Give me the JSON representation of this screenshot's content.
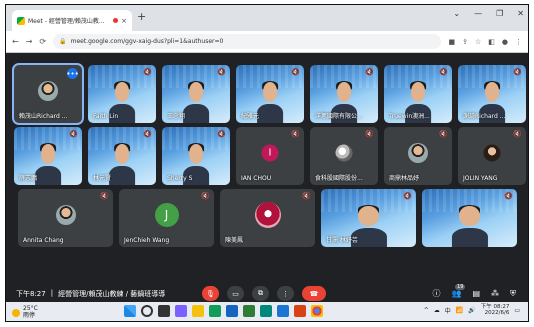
{
  "browser": {
    "tab_title": "Meet - 經營管理/賴茂山教...",
    "tab_close": "×",
    "new_tab": "+",
    "window_controls": [
      "⌄",
      "—",
      "❐",
      "✕"
    ],
    "url": "meet.google.com/ggv-xaig-dus?pli=1&authuser=0"
  },
  "participants_row1": [
    {
      "name": "賴茂山Richard ...",
      "style": "dark",
      "avatar": "face"
    },
    {
      "name": "Faith Lin",
      "style": "blue"
    },
    {
      "name": "王念翔",
      "style": "blue"
    },
    {
      "name": "紀雅元",
      "style": "blue"
    },
    {
      "name": "洋蔥國際有限公...",
      "style": "blue"
    },
    {
      "name": "Truewin澳洲...",
      "style": "blue"
    },
    {
      "name": "謝琦Richard ...",
      "style": "blue"
    }
  ],
  "participants_row2": [
    {
      "name": "薛志鵬",
      "style": "blue"
    },
    {
      "name": "林元賢",
      "style": "blue"
    },
    {
      "name": "Sherry S",
      "style": "blue"
    },
    {
      "name": "IAN CHOU",
      "style": "dark",
      "avatar": "I"
    },
    {
      "name": "食科股國際股份...",
      "style": "dark",
      "avatar": "pic"
    },
    {
      "name": "商鼎林品妤",
      "style": "dark",
      "avatar": "face"
    },
    {
      "name": "JOLIN YANG",
      "style": "dark",
      "avatar": "jolin"
    }
  ],
  "participants_row3": [
    {
      "name": "Annita Chang",
      "style": "dark",
      "avatar": "face"
    },
    {
      "name": "JenChieh Wang",
      "style": "dark",
      "avatar": "J"
    },
    {
      "name": "陳美鳳",
      "style": "dark",
      "avatar": "red"
    },
    {
      "name": "甘霈 林妤芸",
      "style": "blue"
    },
    {
      "name": "",
      "style": "blue"
    }
  ],
  "controls": {
    "time": "下午8:27",
    "separator": "|",
    "meeting_title": "經營管理/賴茂山教練 / 藝鍋班導導",
    "participant_count": "19"
  },
  "taskbar": {
    "temperature": "25°C",
    "weather": "雨停",
    "ime": "中",
    "clock_time": "下午 08:27",
    "clock_date": "2022/6/6"
  }
}
